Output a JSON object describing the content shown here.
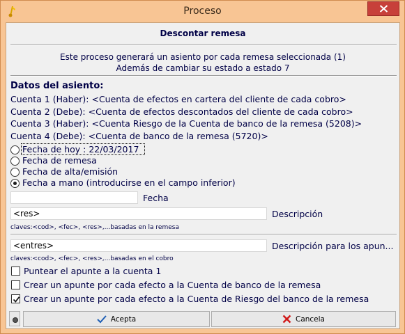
{
  "window": {
    "title": "Proceso"
  },
  "header": {
    "heading": "Descontar remesa",
    "intro_line1": "Este proceso generará un asiento por cada remesa seleccionada (1)",
    "intro_line2": "Además de cambiar su estado a estado 7"
  },
  "accounts": {
    "section_title": "Datos del asiento:",
    "lines": [
      "Cuenta 1 (Haber): <Cuenta de efectos en cartera del cliente de cada cobro>",
      "Cuenta 2 (Debe): <Cuenta de efectos descontados del cliente de cada cobro>",
      "Cuenta 3 (Haber): <Cuenta Riesgo de la Cuenta de banco de la remesa (5208)>",
      "Cuenta 4 (Debe): <Cuenta de banco de la remesa (5720)>"
    ]
  },
  "date_options": {
    "selected_index": 3,
    "items": [
      "Fecha de hoy : 22/03/2017",
      "Fecha de remesa",
      "Fecha de alta/emisión",
      "Fecha a mano (introducirse en el campo inferior)"
    ]
  },
  "fecha": {
    "label": "Fecha",
    "value": ""
  },
  "descripcion": {
    "value": "<res>",
    "label": "Descripción",
    "hint": "claves:<cod>, <fec>, <res>,...basadas en la remesa"
  },
  "descripcion_apuntes": {
    "value": "<entres>",
    "label": "Descripción para los apun...",
    "hint": "claves:<cod>, <fec>, <res>,...basadas en el cobro"
  },
  "checks": [
    {
      "label": "Puntear el apunte a la cuenta 1",
      "checked": false
    },
    {
      "label": "Crear un apunte por cada efecto a la Cuenta de banco de la remesa",
      "checked": false
    },
    {
      "label": "Crear un apunte por cada efecto a la Cuenta de Riesgo del banco de la remesa",
      "checked": true
    }
  ],
  "buttons": {
    "accept": "Acepta",
    "cancel": "Cancela"
  },
  "colors": {
    "titlebar": "#f8c594",
    "close": "#c7403a",
    "text": "#000046"
  }
}
